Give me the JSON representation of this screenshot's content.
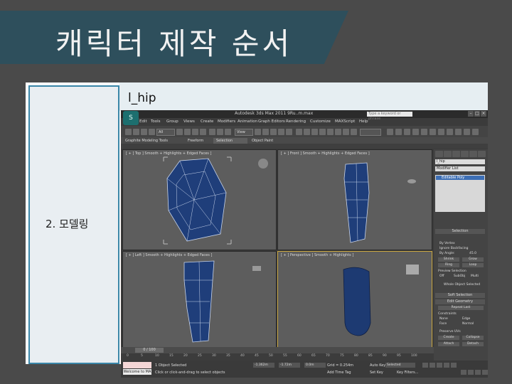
{
  "slide": {
    "title": "캐릭터 제작 순서",
    "step_label": "2. 모델링",
    "caption": "l_hip"
  },
  "app": {
    "title": "Autodesk 3ds Max  2011    9Ru..m.max",
    "search_placeholder": "Type a keyword or phrase",
    "menu": [
      "Edit",
      "Tools",
      "Group",
      "Views",
      "Create",
      "Modifiers",
      "Animation",
      "Graph Editors",
      "Rendering",
      "Customize",
      "MAXScript",
      "Help"
    ],
    "toolbar": {
      "filter_value": "All",
      "view_value": "View"
    },
    "ribbon_tabs": [
      "Graphite Modeling Tools",
      "Freeform",
      "Selection",
      "Object Paint"
    ],
    "active_ribbon_tab": "Selection",
    "viewports": [
      {
        "label": "[ + ] Top ] Smooth + Highlights + Edged Faces ]"
      },
      {
        "label": "[ + ] Front ] Smooth + Highlights + Edged Faces ]"
      },
      {
        "label": "[ + ] Left ] Smooth + Highlights + Edged Faces ]"
      },
      {
        "label": "[ + ] Perspective ] Smooth + Highlights ]"
      }
    ],
    "command_panel": {
      "object_name": "l_hip",
      "modifier_list": "Modifier List",
      "stack_item": "Editable Poly",
      "selection_rollout": "Selection",
      "by_vertex": "By Vertex",
      "ignore_backfacing": "Ignore Backfacing",
      "by_angle": "By Angle:",
      "angle_value": "45.0",
      "shrink": "Shrink",
      "grow": "Grow",
      "ring": "Ring",
      "loop": "Loop",
      "preview_selection": "Preview Selection",
      "preview_opts": [
        "Off",
        "SubObj",
        "Multi"
      ],
      "whole_object": "Whole Object Selected",
      "soft_selection": "Soft Selection",
      "edit_geometry": "Edit Geometry",
      "repeat_last": "Repeat Last",
      "constraints": "Constraints",
      "constraint_opts": [
        "None",
        "Edge",
        "Face",
        "Normal"
      ],
      "preserve_uvs": "Preserve UVs",
      "create": "Create",
      "collapse": "Collapse",
      "attach": "Attach",
      "detach": "Detach"
    },
    "timeline": {
      "slider": "0 / 100",
      "ticks": [
        "0",
        "5",
        "10",
        "15",
        "20",
        "25",
        "30",
        "35",
        "40",
        "45",
        "50",
        "55",
        "60",
        "65",
        "70",
        "75",
        "80",
        "85",
        "90",
        "95",
        "100"
      ]
    },
    "status": {
      "objects_selected": "1 Object Selected",
      "prompt": "Click or click-and-drag to select objects",
      "welcome": "Welcome to MA",
      "x": "-1.362m",
      "y": "-1.72m",
      "z": "0.0m",
      "grid": "Grid = 0.254m",
      "add_time_tag": "Add Time Tag",
      "auto_key": "Auto Key",
      "selected": "Selected",
      "set_key": "Set Key",
      "key_filters": "Key Filters..."
    }
  },
  "colors": {
    "title_band": "#2e4f5c",
    "panel_accent": "#3a86a8",
    "mesh_fill": "#1f3e7a",
    "mesh_line": "#c8d4ea",
    "active_viewport": "#c9a640"
  }
}
